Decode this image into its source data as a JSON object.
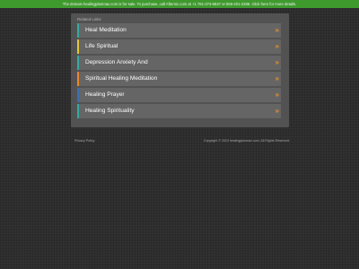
{
  "banner": {
    "text": "The domain healingplusmax.com is for sale. To purchase, call Afternic.com at +1 781-373-6847 or 855-201-2286. Click here for more details."
  },
  "panel": {
    "title": "Related Links",
    "items": [
      {
        "label": "Heal Meditation",
        "arrow": "»",
        "color": "#3aa8a0"
      },
      {
        "label": "Life Spiritual",
        "arrow": "»",
        "color": "#e0c93a"
      },
      {
        "label": "Depression Anxiety And",
        "arrow": "»",
        "color": "#3aa8a0"
      },
      {
        "label": "Spiritual Healing Meditation",
        "arrow": "»",
        "color": "#e88a2a"
      },
      {
        "label": "Healing Prayer",
        "arrow": "»",
        "color": "#3a6fb0"
      },
      {
        "label": "Healing Spirituality",
        "arrow": "»",
        "color": "#3aa8a0"
      }
    ]
  },
  "footer": {
    "privacy": "Privacy Policy",
    "copyright": "Copyright © 2024 healingplusmax.com. All Rights Reserved."
  }
}
